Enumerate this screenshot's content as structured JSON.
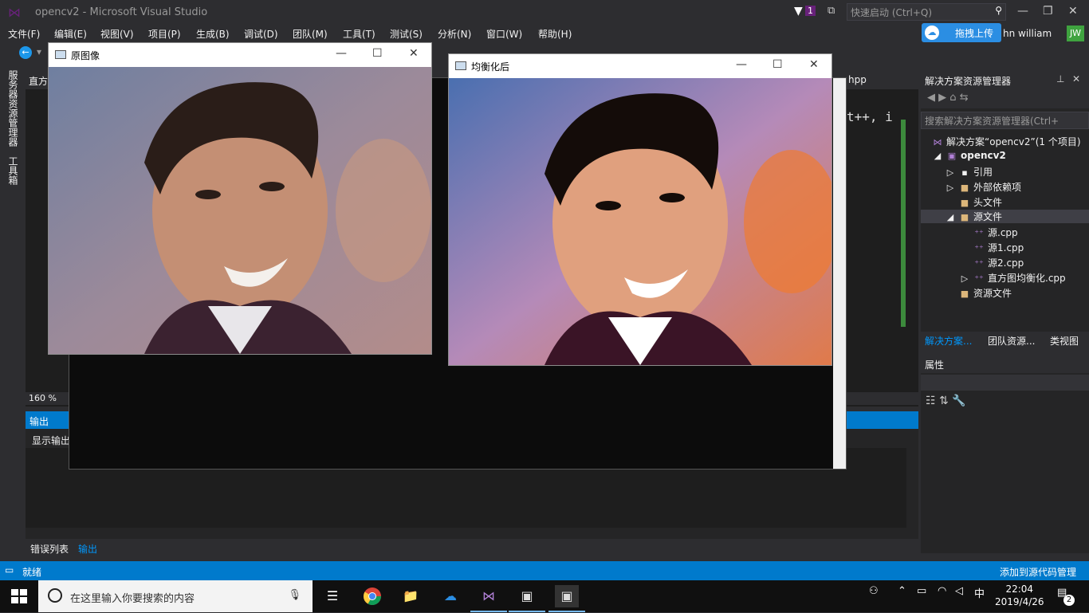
{
  "titlebar": {
    "title": "opencv2 - Microsoft Visual Studio",
    "notification_count": "1",
    "quick_launch_placeholder": "快速启动 (Ctrl+Q)"
  },
  "menu": {
    "items": [
      "文件(F)",
      "编辑(E)",
      "视图(V)",
      "项目(P)",
      "生成(B)",
      "调试(D)",
      "团队(M)",
      "工具(T)",
      "测试(S)",
      "分析(N)",
      "窗口(W)",
      "帮助(H)"
    ]
  },
  "account": {
    "upload_label": "拖拽上传",
    "user_name": "hn william",
    "initials": "JW"
  },
  "left_tabs": {
    "server_explorer": "服务器资源管理器",
    "toolbox": "工具箱"
  },
  "editor": {
    "tab_fragment": "直方",
    "hpp_tab": "hpp",
    "code_fragment": "t++, i",
    "zoom": "160 %"
  },
  "output_panel": {
    "title": "输出",
    "show_output_label": "显示输出"
  },
  "bottom_tabs": {
    "error_list": "错误列表",
    "output": "输出"
  },
  "solution_explorer": {
    "title": "解决方案资源管理器",
    "search_placeholder": "搜索解决方案资源管理器(Ctrl+",
    "tree": [
      {
        "label": "解决方案“opencv2”(1 个项目)",
        "icon": "solution-icon",
        "level": 0
      },
      {
        "label": "opencv2",
        "icon": "project-icon",
        "level": 1,
        "bold": true
      },
      {
        "label": "引用",
        "icon": "references-icon",
        "level": 2
      },
      {
        "label": "外部依赖项",
        "icon": "folder-icon",
        "level": 2
      },
      {
        "label": "头文件",
        "icon": "folder-icon",
        "level": 2
      },
      {
        "label": "源文件",
        "icon": "folder-open-icon",
        "level": 2,
        "selected": true
      },
      {
        "label": "源.cpp",
        "icon": "cpp-file-icon",
        "level": 3
      },
      {
        "label": "源1.cpp",
        "icon": "cpp-file-icon",
        "level": 3
      },
      {
        "label": "源2.cpp",
        "icon": "cpp-file-icon",
        "level": 3
      },
      {
        "label": "直方图均衡化.cpp",
        "icon": "cpp-file-icon",
        "level": 3
      },
      {
        "label": "资源文件",
        "icon": "folder-icon",
        "level": 2
      }
    ],
    "tabs": [
      "解决方案...",
      "团队资源...",
      "类视图"
    ]
  },
  "properties": {
    "title": "属性"
  },
  "statusbar": {
    "ready": "就绪",
    "source_control": "添加到源代码管理"
  },
  "windows": {
    "original": {
      "title": "原图像"
    },
    "equalized": {
      "title": "均衡化后"
    }
  },
  "taskbar": {
    "search_placeholder": "在这里输入你要搜索的内容",
    "ime": "中",
    "time": "22:04",
    "date": "2019/4/26",
    "notifications": "2"
  },
  "colors": {
    "vs_dark": "#2d2d30",
    "accent_blue": "#007acc",
    "vs_purple": "#68217a"
  }
}
